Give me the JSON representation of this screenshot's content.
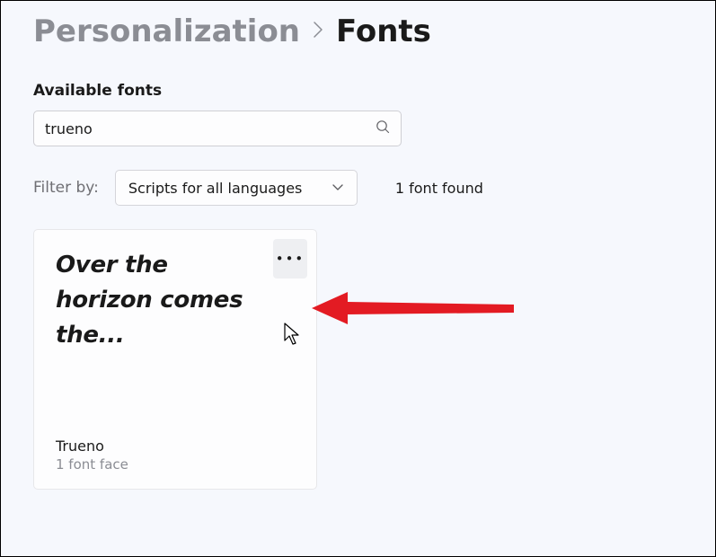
{
  "breadcrumb": {
    "parent": "Personalization",
    "current": "Fonts"
  },
  "section": {
    "title": "Available fonts"
  },
  "search": {
    "value": "trueno",
    "placeholder": ""
  },
  "filter": {
    "label": "Filter by:",
    "selected": "Scripts for all languages"
  },
  "results": {
    "count_text": "1 font found"
  },
  "font_card": {
    "preview": "Over the horizon comes the...",
    "name": "Trueno",
    "faces": "1 font face"
  }
}
